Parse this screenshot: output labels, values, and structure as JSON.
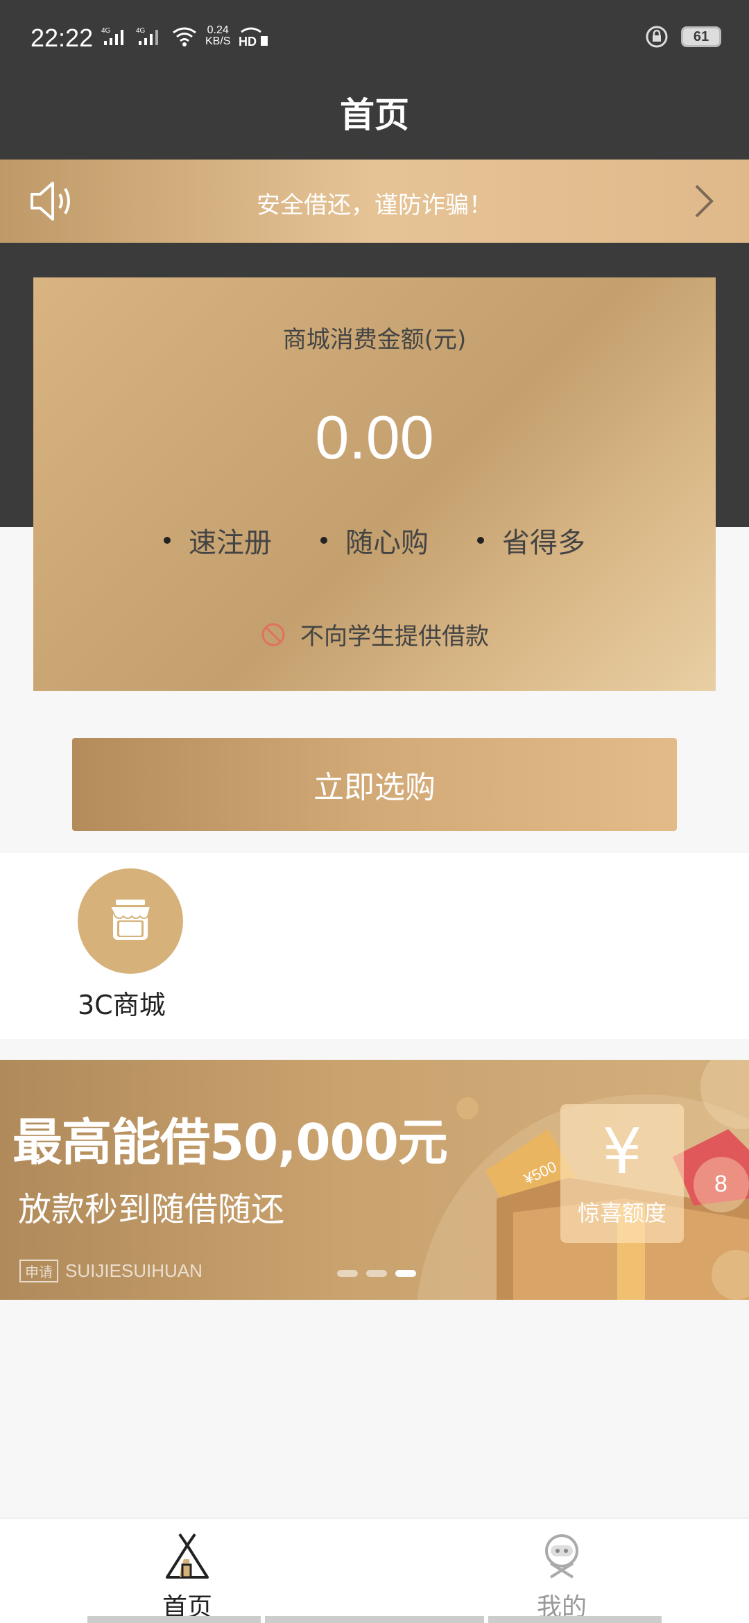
{
  "status_bar": {
    "time": "22:22",
    "net_speed_value": "0.24",
    "net_speed_unit": "KB/S",
    "battery": "61"
  },
  "header": {
    "title": "首页"
  },
  "notice": {
    "text": "安全借还，谨防诈骗！"
  },
  "card": {
    "label": "商城消费金额(元)",
    "amount": "0.00",
    "features": [
      "速注册",
      "随心购",
      "省得多"
    ],
    "disclaimer": "不向学生提供借款"
  },
  "buy_button": {
    "label": "立即选购"
  },
  "shortcuts": [
    {
      "label": "3C商城",
      "icon": "shop-icon"
    }
  ],
  "banner": {
    "title": "最高能借50,000元",
    "subtitle": "放款秒到随借随还",
    "brand_tag": "申请",
    "brand_text": "SUIJIESUIHUAN",
    "card_symbol": "¥",
    "card_text": "惊喜额度",
    "coupon_text": "¥500",
    "envelope_text": "8"
  },
  "tab_bar": {
    "items": [
      {
        "label": "首页",
        "active": true
      },
      {
        "label": "我的",
        "active": false
      }
    ]
  },
  "colors": {
    "dark_header": "#3b3b3b",
    "gold": "#d6b27a",
    "gold_light": "#e6c395",
    "gold_dark": "#b48c5c"
  }
}
